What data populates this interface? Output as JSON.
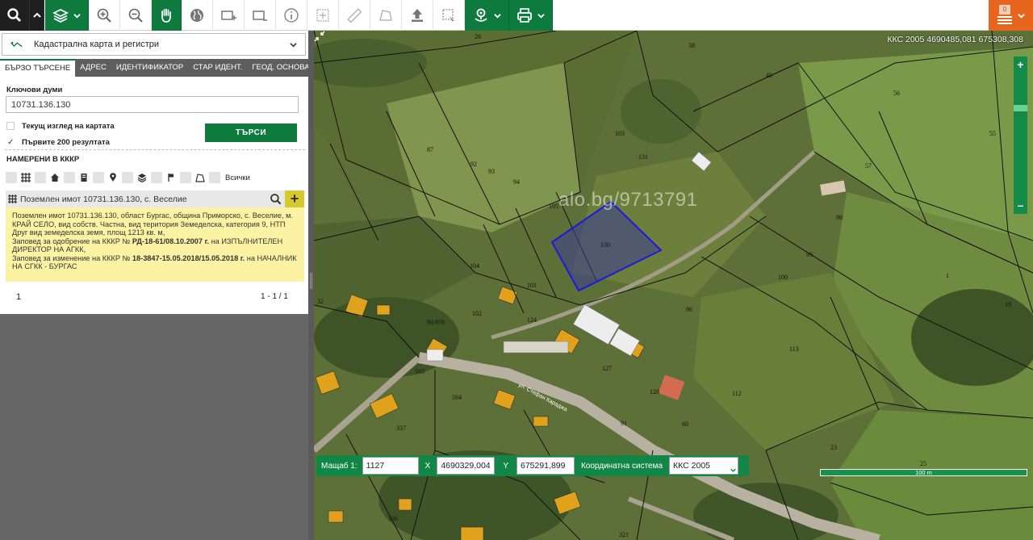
{
  "toolbar": {
    "icons": [
      "search-icon",
      "layers-icon",
      "zoom-in-icon",
      "zoom-out-icon",
      "pan-hand-icon",
      "globe-icon",
      "select-rect-icon",
      "select-poly-icon",
      "info-icon",
      "measure-point-icon",
      "ruler-icon",
      "area-icon",
      "upload-icon",
      "select-dashed-icon",
      "location-icon",
      "print-icon",
      "menu-icon"
    ],
    "badge": "0"
  },
  "panel": {
    "layer_select": "Кадастрална карта и регистри",
    "tabs": [
      "БЪРЗО ТЪРСЕНЕ",
      "АДРЕС",
      "ИДЕНТИФИКАТОР",
      "СТАР ИДЕНТ.",
      "ГЕОД. ОСНОВА"
    ],
    "active_tab": 0,
    "keywords_label": "Ключови думи",
    "keywords_value": "10731.136.130",
    "checkbox_current_view": "Текущ изглед на картата",
    "checkbox_first_200": "Първите 200 резултата",
    "search_button": "ТЪРСИ",
    "found_label": "НАМЕРЕНИ В КККР",
    "all_label": "Всички",
    "result": {
      "title": "Поземлен имот 10731.136.130, с. Веселие",
      "line1": "Поземлен имот 10731.136.130, област Бургас, община Приморско, с. Веселие, м. КРАЙ СЕЛО, вид собств. Частна, вид територия Земеделска, категория 9, НТП Друг вид земеделска земя, площ 1213 кв. м,",
      "line2_pre": "Заповед за одобрение на КККР № ",
      "line2_bold": "РД-18-61/08.10.2007 г.",
      "line2_post": " на ИЗПЪЛНИТЕЛЕН ДИРЕКТОР НА АГКК,",
      "line3_pre": "Заповед за изменение на КККР № ",
      "line3_bold": "18-3847-15.05.2018/15.05.2018 г.",
      "line3_post": " на НАЧАЛНИК НА СГКК - БУРГАС"
    },
    "pager_page": "1",
    "pager_range": "1 - 1 / 1"
  },
  "map": {
    "coord_readout": "ККС 2005 4690485,081 675308,308",
    "watermark": "alo.bg/9713791",
    "parcel_labels": [
      "26",
      "38",
      "40",
      "56",
      "55",
      "87",
      "92",
      "93",
      "94",
      "103",
      "131",
      "105",
      "130",
      "57",
      "98",
      "99",
      "100",
      "104",
      "101",
      "102",
      "90.978",
      "124",
      "593",
      "594",
      "337",
      "336",
      "127",
      "128",
      "96",
      "113",
      "112",
      "91",
      "60",
      "23",
      "25",
      "19",
      "1",
      "32",
      "321"
    ],
    "road_label": "ул. Стефан Караджа",
    "scale_label": "Мащаб  1:",
    "scale_value": "1127",
    "x_label": "X",
    "x_value": "4690329,004",
    "y_label": "Y",
    "y_value": "675291,899",
    "coord_system_label": "Координатна система",
    "coord_system_value": "ККС 2005",
    "scalebar_text": "100 m"
  }
}
